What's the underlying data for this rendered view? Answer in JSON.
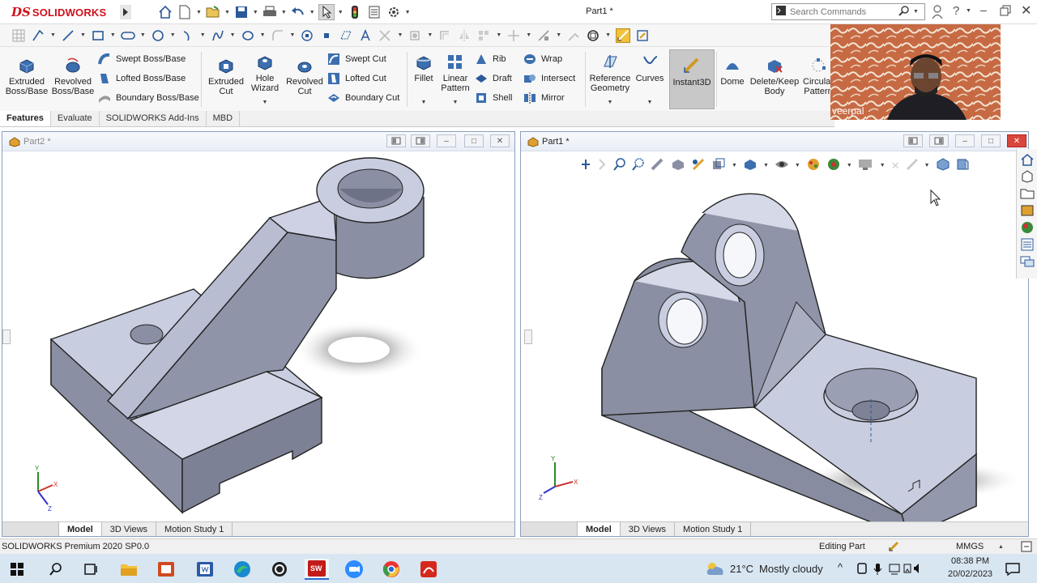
{
  "app": {
    "brand_ds": "DS",
    "brand_name": "SOLIDWORKS",
    "document_title": "Part1 *"
  },
  "search": {
    "placeholder": "Search Commands"
  },
  "command_manager": {
    "extruded_boss": "Extruded Boss/Base",
    "revolved_boss": "Revolved Boss/Base",
    "swept_boss": "Swept Boss/Base",
    "lofted_boss": "Lofted Boss/Base",
    "boundary_boss": "Boundary Boss/Base",
    "extruded_cut": "Extruded Cut",
    "hole_wizard": "Hole Wizard",
    "revolved_cut": "Revolved Cut",
    "swept_cut": "Swept Cut",
    "lofted_cut": "Lofted Cut",
    "boundary_cut": "Boundary Cut",
    "fillet": "Fillet",
    "linear_pattern": "Linear Pattern",
    "rib": "Rib",
    "draft": "Draft",
    "shell": "Shell",
    "wrap": "Wrap",
    "intersect": "Intersect",
    "mirror": "Mirror",
    "reference_geometry": "Reference Geometry",
    "curves": "Curves",
    "instant3d": "Instant3D",
    "dome": "Dome",
    "delete_keep_body": "Delete/Keep Body",
    "circular_pattern": "Circular Pattern"
  },
  "tabs": [
    "Features",
    "Evaluate",
    "SOLIDWORKS Add-Ins",
    "MBD"
  ],
  "webcam": {
    "name": "veerpal"
  },
  "left_view": {
    "title": "Part2 *",
    "tabs": [
      "Model",
      "3D Views",
      "Motion Study 1"
    ]
  },
  "right_view": {
    "title": "Part1 *",
    "tabs": [
      "Model",
      "3D Views",
      "Motion Study 1"
    ]
  },
  "statusbar": {
    "product": "SOLIDWORKS Premium 2020 SP0.0",
    "mode": "Editing Part",
    "units": "MMGS"
  },
  "taskbar": {
    "temperature": "21°C",
    "weather": "Mostly cloudy",
    "time": "08:38 PM",
    "date": "20/02/2023"
  },
  "colors": {
    "accent": "#d0101a",
    "selection_blue": "#2a5a9a",
    "model_grey": "#9aa0b4",
    "model_face": "#c9cde0"
  }
}
